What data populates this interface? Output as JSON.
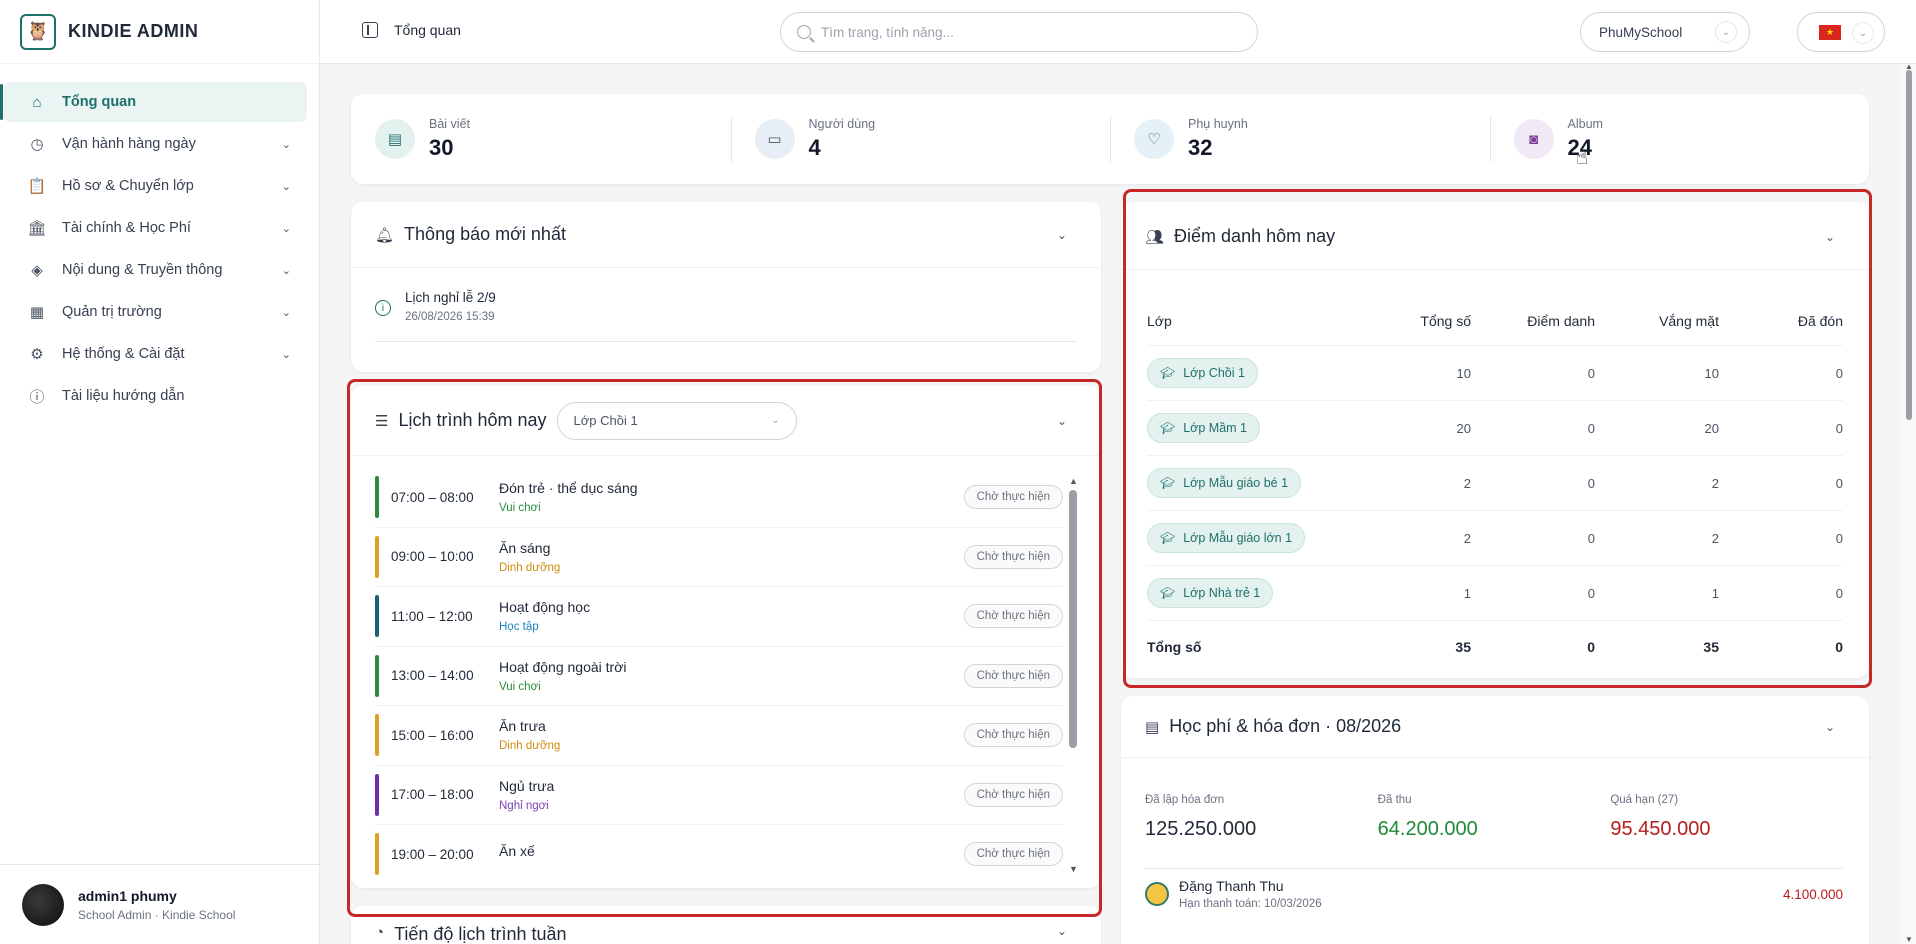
{
  "brand": {
    "name": "KINDIE ADMIN"
  },
  "sidebar": {
    "items": [
      {
        "label": "Tổng quan",
        "icon": "home-icon",
        "active": true
      },
      {
        "label": "Vận hành hàng ngày",
        "icon": "clock-icon",
        "expandable": true
      },
      {
        "label": "Hồ sơ & Chuyển lớp",
        "icon": "clipboard-icon",
        "expandable": true
      },
      {
        "label": "Tài chính & Học Phí",
        "icon": "bank-icon",
        "expandable": true
      },
      {
        "label": "Nội dung & Truyền thông",
        "icon": "layers-icon",
        "expandable": true
      },
      {
        "label": "Quản trị trường",
        "icon": "building-icon",
        "expandable": true
      },
      {
        "label": "Hệ thống & Cài đặt",
        "icon": "gear-icon",
        "expandable": true
      },
      {
        "label": "Tài liệu hướng dẫn",
        "icon": "help-icon",
        "expandable": false
      }
    ],
    "user": {
      "name": "admin1 phumy",
      "role": "School Admin · Kindie School"
    }
  },
  "topbar": {
    "breadcrumb": "Tổng quan",
    "search_placeholder": "Tìm trang, tính năng...",
    "school": "PhuMySchool",
    "language_flag": "vn-flag-icon"
  },
  "stats": [
    {
      "label": "Bài viết",
      "value": "30",
      "icon": "newspaper-icon",
      "color": "#e3f2ef",
      "icon_color": "#1f6f6b"
    },
    {
      "label": "Người dùng",
      "value": "4",
      "icon": "id-card-icon",
      "color": "#e8eef5",
      "icon_color": "#4b5563"
    },
    {
      "label": "Phụ huynh",
      "value": "32",
      "icon": "heart-handshake-icon",
      "color": "#e6f1f7",
      "icon_color": "#1e6f94"
    },
    {
      "label": "Album",
      "value": "24",
      "icon": "camera-icon",
      "color": "#f1e9f5",
      "icon_color": "#7b3f98"
    }
  ],
  "notifications": {
    "title": "Thông báo mới nhất",
    "items": [
      {
        "title": "Lịch nghỉ lễ 2/9",
        "date": "26/08/2026 15:39"
      }
    ]
  },
  "schedule": {
    "title": "Lịch trình hôm nay",
    "class_selected": "Lớp Chồi 1",
    "items": [
      {
        "time": "07:00 – 08:00",
        "name": "Đón trẻ · thể dục sáng",
        "category": "Vui chơi",
        "cat_color": "#2e8b3e",
        "bar_color": "#2e8b3e",
        "status": "Chờ thực hiện"
      },
      {
        "time": "09:00 – 10:00",
        "name": "Ăn sáng",
        "category": "Dinh dưỡng",
        "cat_color": "#d08a12",
        "bar_color": "#e0a020",
        "status": "Chờ thực hiện"
      },
      {
        "time": "11:00 – 12:00",
        "name": "Hoạt động học",
        "category": "Học tập",
        "cat_color": "#1e7fb8",
        "bar_color": "#1a5f7a",
        "status": "Chờ thực hiện"
      },
      {
        "time": "13:00 – 14:00",
        "name": "Hoạt động ngoài trời",
        "category": "Vui chơi",
        "cat_color": "#2e8b3e",
        "bar_color": "#2e8b3e",
        "status": "Chờ thực hiện"
      },
      {
        "time": "15:00 – 16:00",
        "name": "Ăn trưa",
        "category": "Dinh dưỡng",
        "cat_color": "#d08a12",
        "bar_color": "#e0a020",
        "status": "Chờ thực hiện"
      },
      {
        "time": "17:00 – 18:00",
        "name": "Ngủ trưa",
        "category": "Nghỉ ngơi",
        "cat_color": "#7b3fb8",
        "bar_color": "#6a2cb0",
        "status": "Chờ thực hiện"
      },
      {
        "time": "19:00 – 20:00",
        "name": "Ăn xế",
        "category": "",
        "cat_color": "#d08a12",
        "bar_color": "#e0a020",
        "status": "Chờ thực hiện"
      }
    ]
  },
  "progress": {
    "title": "Tiến độ lịch trình tuần"
  },
  "attendance": {
    "title": "Điểm danh hôm nay",
    "headers": [
      "Lớp",
      "Tổng số",
      "Điểm danh",
      "Vắng mặt",
      "Đã đón"
    ],
    "rows": [
      {
        "class": "Lớp Chồi 1",
        "total": "10",
        "present": "0",
        "absent": "10",
        "picked": "0"
      },
      {
        "class": "Lớp Mầm 1",
        "total": "20",
        "present": "0",
        "absent": "20",
        "picked": "0"
      },
      {
        "class": "Lớp Mẫu giáo bé 1",
        "total": "2",
        "present": "0",
        "absent": "2",
        "picked": "0"
      },
      {
        "class": "Lớp Mẫu giáo lớn 1",
        "total": "2",
        "present": "0",
        "absent": "2",
        "picked": "0"
      },
      {
        "class": "Lớp Nhà trẻ 1",
        "total": "1",
        "present": "0",
        "absent": "1",
        "picked": "0"
      }
    ],
    "total_row": {
      "label": "Tổng số",
      "total": "35",
      "present": "0",
      "absent": "35",
      "picked": "0"
    }
  },
  "fees": {
    "title": "Học phí & hóa đơn · 08/2026",
    "summary": [
      {
        "label": "Đã lập hóa đơn",
        "value": "125.250.000",
        "color": "#1f2937"
      },
      {
        "label": "Đã thu",
        "value": "64.200.000",
        "color": "#1e8a3a"
      },
      {
        "label": "Quá hạn (27)",
        "value": "95.450.000",
        "color": "#b91c1c"
      }
    ],
    "items": [
      {
        "name": "Đặng Thanh Thu",
        "due": "Hạn thanh toán: 10/03/2026",
        "amount": "4.100.000"
      }
    ]
  }
}
